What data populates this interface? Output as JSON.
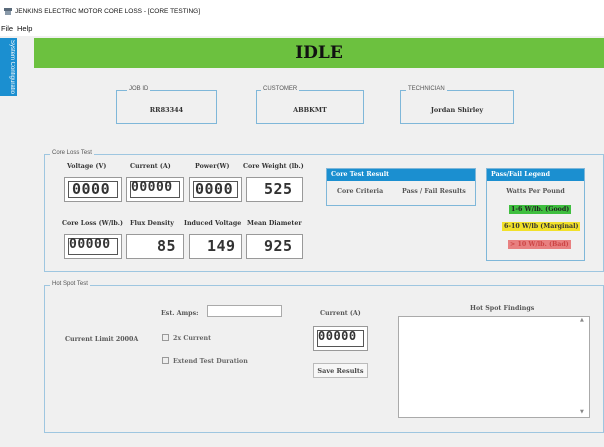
{
  "window": {
    "title": "JENKINS ELECTRIC MOTOR CORE LOSS - [CORE TESTING]"
  },
  "menu": {
    "items": [
      "File",
      "Help"
    ]
  },
  "sidebar": {
    "tab_label": "System Configuration"
  },
  "status": {
    "text": "IDLE",
    "color": "#6cc13f"
  },
  "info": {
    "job_id": {
      "label": "JOB ID",
      "value": "RR83344"
    },
    "customer": {
      "label": "CUSTOMER",
      "value": "ABBKMT"
    },
    "technician": {
      "label": "TECHNICIAN",
      "value": "Jordan Shirley"
    }
  },
  "core_loss": {
    "title": "Core Loss Test",
    "meters": [
      {
        "label": "Voltage (V)",
        "value": "0000"
      },
      {
        "label": "Current (A)",
        "value": "00000"
      },
      {
        "label": "Power(W)",
        "value": "0000"
      },
      {
        "label": "Core Weight (lb.)",
        "value": "525"
      },
      {
        "label": "Core Loss (W/lb.)",
        "value": "00000"
      },
      {
        "label": "Flux Density",
        "value": "85"
      },
      {
        "label": "Induced Voltage",
        "value": "149"
      },
      {
        "label": "Mean Diameter",
        "value": "925"
      }
    ],
    "result": {
      "title": "Core Test Result",
      "criteria": "Core Criteria",
      "pass_fail": "Pass / Fail Results"
    },
    "legend": {
      "title": "Pass/Fail Legend",
      "subtitle": "Watts Per Pound",
      "good": {
        "text": "1-6 W/lb. (Good)",
        "color": "#3fbf3f"
      },
      "marginal": {
        "text": "6-10 W/lb (Marginal)",
        "color": "#f2e12a"
      },
      "bad": {
        "text": "> 10 W/lb. (Bad)",
        "color": "#e88080"
      }
    }
  },
  "hot_spot": {
    "title": "Hot Spot Test",
    "est_amps_label": "Est. Amps:",
    "current_limit": "Current Limit 2000A",
    "double_current": "2x Current",
    "extend_duration": "Extend Test Duration",
    "current_label": "Current (A)",
    "current_value": "00000",
    "save_button": "Save Results",
    "findings_label": "Hot Spot Findings"
  },
  "accent_color": "#1b8fd0"
}
